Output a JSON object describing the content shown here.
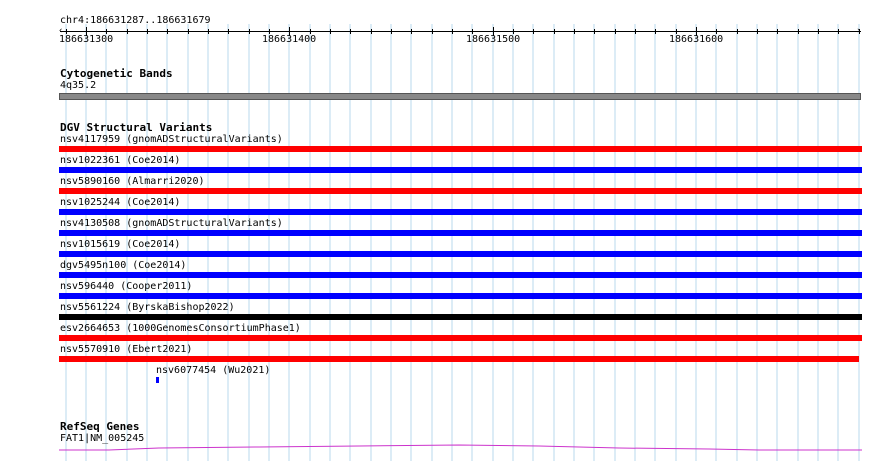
{
  "region": {
    "label": "chr4:186631287..186631679"
  },
  "ruler": {
    "ticks": [
      "186631300",
      "186631400",
      "186631500",
      "186631600"
    ]
  },
  "cytoband": {
    "title": "Cytogenetic Bands",
    "label": "4q35.2",
    "color": "#888888"
  },
  "dgv": {
    "title": "DGV Structural Variants",
    "variants": [
      {
        "label": "nsv4117959 (gnomADStructuralVariants)",
        "color": "#ff0000"
      },
      {
        "label": "nsv1022361 (Coe2014)",
        "color": "#0000ff"
      },
      {
        "label": "nsv5890160 (Almarri2020)",
        "color": "#ff0000"
      },
      {
        "label": "nsv1025244 (Coe2014)",
        "color": "#0000ff"
      },
      {
        "label": "nsv4130508 (gnomADStructuralVariants)",
        "color": "#0000ff"
      },
      {
        "label": "nsv1015619 (Coe2014)",
        "color": "#0000ff"
      },
      {
        "label": "dgv5495n100 (Coe2014)",
        "color": "#0000ff"
      },
      {
        "label": "nsv596440 (Cooper2011)",
        "color": "#0000ff"
      },
      {
        "label": "nsv5561224 (ByrskaBishop2022)",
        "color": "#000000"
      },
      {
        "label": "esv2664653 (1000GenomesConsortiumPhase1)",
        "color": "#ff0000"
      },
      {
        "label": "nsv5570910 (Ebert2021)",
        "color": "#ff0000"
      },
      {
        "label": "nsv6077454 (Wu2021)",
        "color": "#0000ff"
      }
    ]
  },
  "refseq": {
    "title": "RefSeq Genes",
    "label": "FAT1|NM_005245",
    "color": "#cc33cc"
  }
}
